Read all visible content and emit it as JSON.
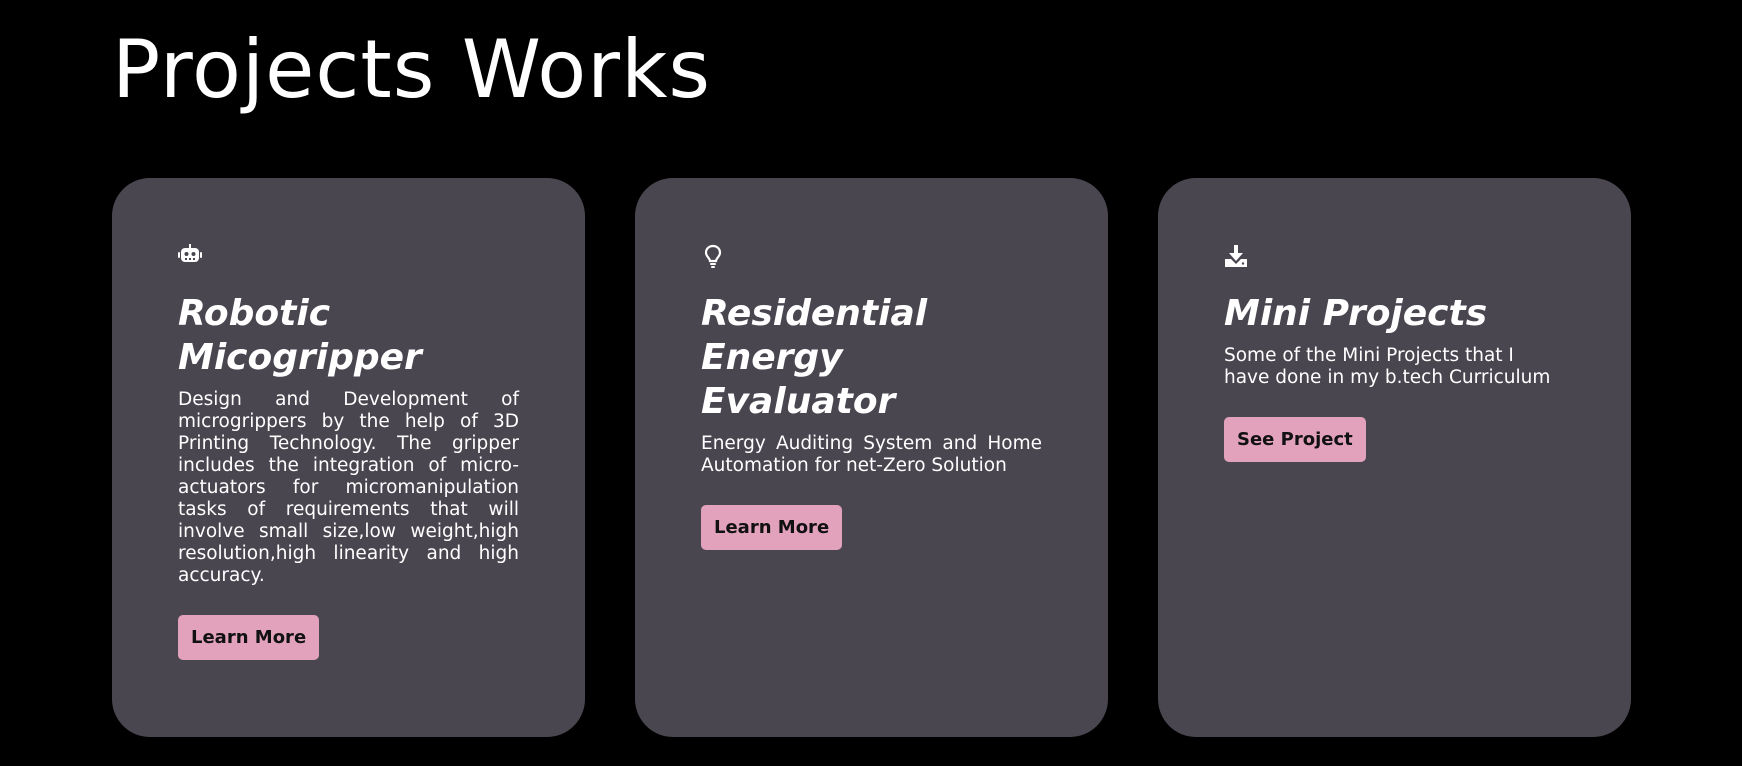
{
  "page": {
    "title": "Projects Works"
  },
  "cards": [
    {
      "icon": "robot-icon",
      "title": "Robotic Micogripper",
      "description": "Design and Development of microgrippers by the help of 3D Printing Technology. The gripper includes the integration of micro-actuators for micromanipulation tasks of requirements that will involve small size,low weight,high resolution,high linearity and high accuracy.",
      "button_label": "Learn More"
    },
    {
      "icon": "lightbulb-icon",
      "title": "Residential Energy Evaluator",
      "description": "Energy Auditing System and Home Automation for net-Zero Solution",
      "button_label": "Learn More"
    },
    {
      "icon": "download-icon",
      "title": "Mini Projects",
      "description": "Some of the Mini Projects that I have done in my b.tech Curriculum",
      "button_label": "See Project"
    }
  ],
  "colors": {
    "background": "#000000",
    "card": "#4a4650",
    "button": "#e3a2bc",
    "text": "#ffffff"
  }
}
